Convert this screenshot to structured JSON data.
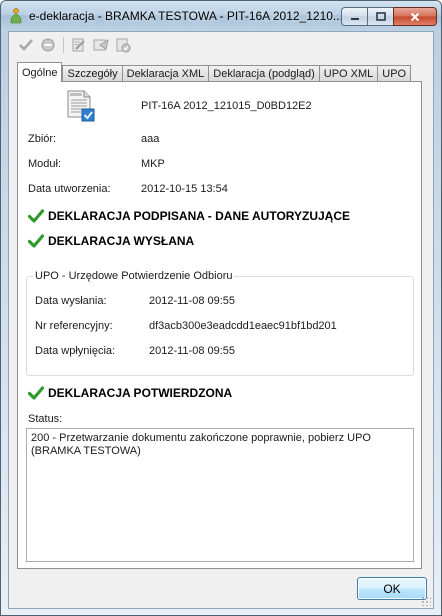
{
  "window": {
    "title": "e-deklaracja - BRAMKA TESTOWA - PIT-16A 2012_1210..."
  },
  "toolbar": {
    "buttons": [
      "check-icon",
      "stop-icon",
      "edit-document-icon",
      "send-document-icon",
      "approve-document-icon"
    ]
  },
  "tabs": [
    {
      "label": "Ogólne",
      "active": true
    },
    {
      "label": "Szczegóły",
      "active": false
    },
    {
      "label": "Deklaracja XML",
      "active": false
    },
    {
      "label": "Deklaracja (podgląd)",
      "active": false
    },
    {
      "label": "UPO XML",
      "active": false
    },
    {
      "label": "UPO",
      "active": false
    }
  ],
  "general": {
    "document_name": "PIT-16A 2012_121015_D0BD12E2",
    "fields": [
      {
        "label": "Zbiór:",
        "value": "aaa"
      },
      {
        "label": "Moduł:",
        "value": "MKP"
      },
      {
        "label": "Data utworzenia:",
        "value": "2012-10-15 13:54"
      }
    ],
    "statuses": {
      "signed": "DEKLARACJA PODPISANA - DANE AUTORYZUJĄCE",
      "sent": "DEKLARACJA WYSŁANA",
      "confirmed": "DEKLARACJA POTWIERDZONA"
    },
    "upo_group": {
      "title": "UPO - Urzędowe Potwierdzenie Odbioru",
      "fields": [
        {
          "label": "Data wysłania:",
          "value": "2012-11-08 09:55"
        },
        {
          "label": "Nr referencyjny:",
          "value": "df3acb300e3eadcdd1eaec91bf1bd201"
        },
        {
          "label": "Data wpłynięcia:",
          "value": "2012-11-08 09:55"
        }
      ]
    },
    "status_label": "Status:",
    "status_text": "200 - Przetwarzanie dokumentu zakończone poprawnie, pobierz UPO (BRAMKA TESTOWA)"
  },
  "footer": {
    "ok_label": "OK"
  },
  "colors": {
    "check_green": "#2e9a2e",
    "tab_border": "#8e8f8f",
    "button_border": "#3c7fb1"
  }
}
